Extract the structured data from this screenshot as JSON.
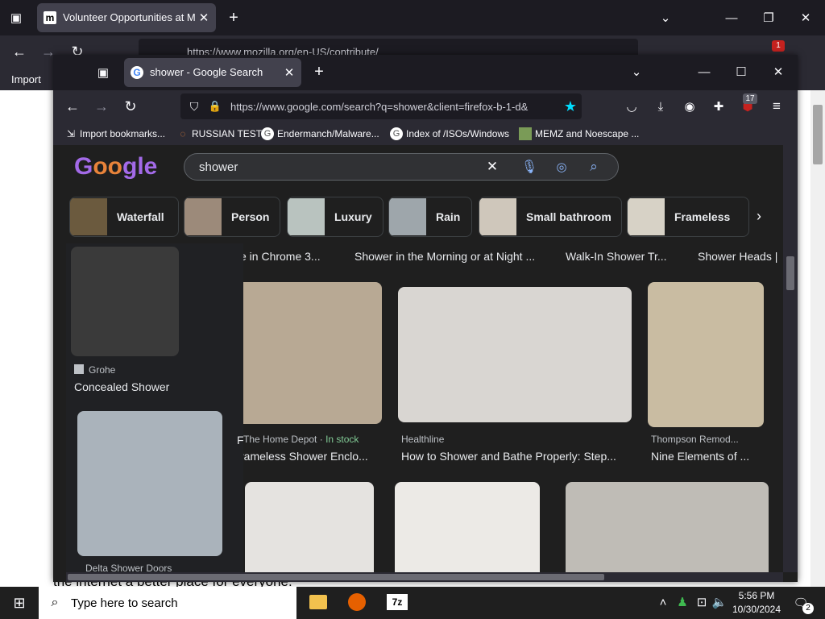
{
  "back_window": {
    "tab_title": "Volunteer Opportunities at Moz",
    "url": "https://www.mozilla.org/en-US/contribute/",
    "bookmark_first": "Import",
    "ext_badge": "1",
    "page_text": "the internet a better place for everyone."
  },
  "front_window": {
    "tab_title": "shower - Google Search",
    "url": "https://www.google.com/search?q=shower&client=firefox-b-1-d&",
    "ext_badge": "17",
    "bookmarks": [
      {
        "label": "Import bookmarks..."
      },
      {
        "label": "RUSSIAN TEST"
      },
      {
        "label": "Endermanch/Malware..."
      },
      {
        "label": "Index of /ISOs/Windows"
      },
      {
        "label": "MEMZ and Noescape ..."
      }
    ]
  },
  "google": {
    "search_value": "shower",
    "chips": [
      {
        "label": "Waterfall",
        "color": "#6b5a3e"
      },
      {
        "label": "Person",
        "color": "#9c8a7a"
      },
      {
        "label": "Luxury",
        "color": "#b9c3bf"
      },
      {
        "label": "Rain",
        "color": "#9ea6ab"
      },
      {
        "label": "Small bathroom",
        "color": "#cfc7bb"
      },
      {
        "label": "Frameless",
        "color": "#d7d2c6"
      }
    ],
    "top_captions": [
      {
        "text": "e in Chrome 3..."
      },
      {
        "text": "Shower in the Morning or at Night ..."
      },
      {
        "text": "Walk-In Shower Tr..."
      },
      {
        "text": "Shower Heads |"
      }
    ],
    "results": [
      {
        "source": "Grohe",
        "title": "Concealed Shower",
        "color": "#3a3a3a"
      },
      {
        "source": "Delta Shower Doors",
        "title": "",
        "color": "#aab3bb"
      },
      {
        "source": "The Home Depot",
        "stock": "In stock",
        "title": "rameless Shower Enclo...",
        "color": "#b8a994"
      },
      {
        "source": "Healthline",
        "title": "How to Shower and Bathe Properly: Step...",
        "color": "#d9d6d2"
      },
      {
        "source": "Thompson Remod...",
        "title": "Nine Elements of ...",
        "color": "#c9bca2"
      },
      {
        "source": "",
        "title": "",
        "color": "#e5e3e0"
      },
      {
        "source": "",
        "title": "",
        "color": "#eceae6"
      },
      {
        "source": "",
        "title": "",
        "color": "#bfbcb6"
      }
    ],
    "side_partial": "F"
  },
  "taskbar": {
    "search_placeholder": "Type here to search",
    "time": "5:56 PM",
    "date": "10/30/2024",
    "notif_count": "2"
  },
  "colors": {
    "accent_blue": "#00ddff",
    "badge_red": "#c5221f"
  }
}
